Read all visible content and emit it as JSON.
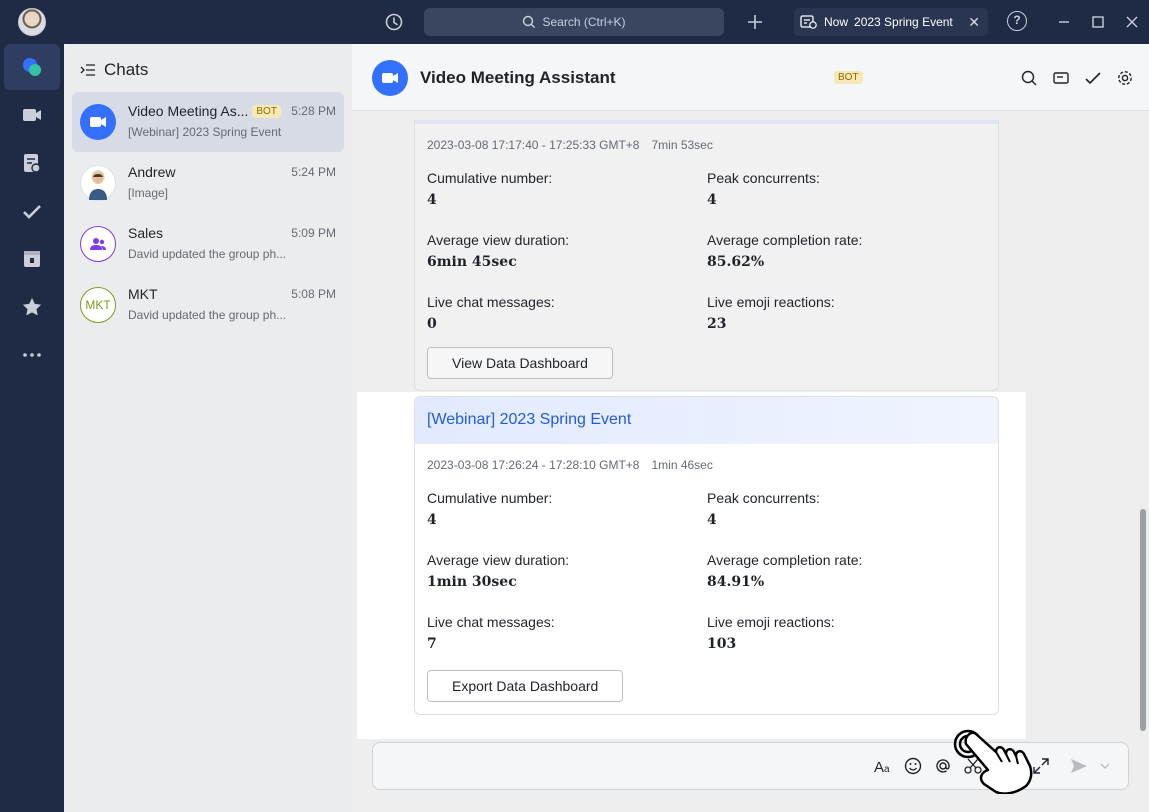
{
  "titlebar": {
    "search_placeholder": "Search (Ctrl+K)",
    "now_label": "Now",
    "now_event": "2023 Spring Event",
    "help": "?"
  },
  "chatlist": {
    "header": "Chats",
    "items": [
      {
        "name": "Video Meeting As...",
        "tag": "BOT",
        "time": "5:28 PM",
        "preview": "[Webinar] 2023 Spring Event"
      },
      {
        "name": "Andrew",
        "time": "5:24 PM",
        "preview": "[Image]"
      },
      {
        "name": "Sales",
        "time": "5:09 PM",
        "preview": "David updated the group ph..."
      },
      {
        "name": "MKT",
        "avatar_text": "MKT",
        "time": "5:08 PM",
        "preview": "David updated the group ph..."
      }
    ]
  },
  "conversation": {
    "title": "Video Meeting Assistant",
    "tag": "BOT",
    "prev_card": {
      "time": "2023-03-08 17:17:40 - 17:25:33 GMT+8",
      "duration": "7min 53sec",
      "stats": [
        {
          "label": "Cumulative number:",
          "value": "4"
        },
        {
          "label": "Peak concurrents:",
          "value": "4"
        },
        {
          "label": "Average view duration:",
          "value": "6min 45sec"
        },
        {
          "label": "Average completion rate:",
          "value": "85.62%"
        },
        {
          "label": "Live chat messages:",
          "value": "0"
        },
        {
          "label": "Live emoji reactions:",
          "value": "23"
        }
      ],
      "button": "View Data Dashboard"
    },
    "card": {
      "title": "[Webinar] 2023 Spring Event",
      "time": "2023-03-08 17:26:24 - 17:28:10 GMT+8",
      "duration": "1min 46sec",
      "stats": [
        {
          "label": "Cumulative number:",
          "value": "4"
        },
        {
          "label": "Peak concurrents:",
          "value": "4"
        },
        {
          "label": "Average view duration:",
          "value": "1min 30sec"
        },
        {
          "label": "Average completion rate:",
          "value": "84.91%"
        },
        {
          "label": "Live chat messages:",
          "value": "7"
        },
        {
          "label": "Live emoji reactions:",
          "value": "103"
        }
      ],
      "button": "Export Data Dashboard"
    }
  },
  "colors": {
    "sidebar": "#1f2a44",
    "accent": "#3370ff",
    "card_title": "#245bdb",
    "sales": "#7f3bf5",
    "mkt": "#7a9c1a"
  }
}
